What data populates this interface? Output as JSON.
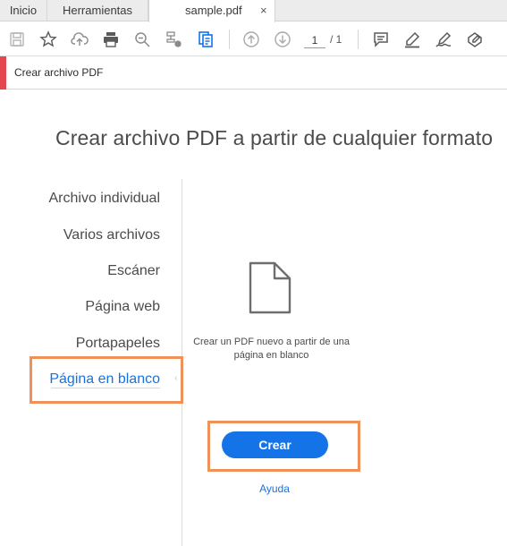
{
  "tabs": {
    "home": "Inicio",
    "tools": "Herramientas",
    "document": "sample.pdf",
    "close_symbol": "×"
  },
  "toolbar": {
    "icons": [
      "save-icon",
      "star-icon",
      "cloud-upload-icon",
      "print-icon",
      "zoom-search-icon",
      "stamp-hand-icon",
      "create-pdf-icon",
      "page-up-icon",
      "page-down-icon",
      "comment-icon",
      "highlight-pen-icon",
      "sign-icon",
      "fill-sign-icon"
    ],
    "page_current": "1",
    "page_total": "/ 1"
  },
  "tool_header": {
    "title": "Crear archivo PDF",
    "accent_color": "#e34850"
  },
  "main": {
    "title": "Crear archivo PDF a partir de cualquier formato",
    "nav": [
      {
        "label": "Archivo individual",
        "active": false
      },
      {
        "label": "Varios archivos",
        "active": false
      },
      {
        "label": "Escáner",
        "active": false
      },
      {
        "label": "Página web",
        "active": false
      },
      {
        "label": "Portapapeles",
        "active": false
      },
      {
        "label": "Página en blanco",
        "active": true
      }
    ],
    "option_icon": "blank-document-icon",
    "description": "Crear un PDF nuevo a partir de una página en blanco",
    "create_button": "Crear",
    "help_link": "Ayuda"
  },
  "colors": {
    "accent_blue": "#1473e6",
    "highlight_orange": "#f0915a"
  }
}
